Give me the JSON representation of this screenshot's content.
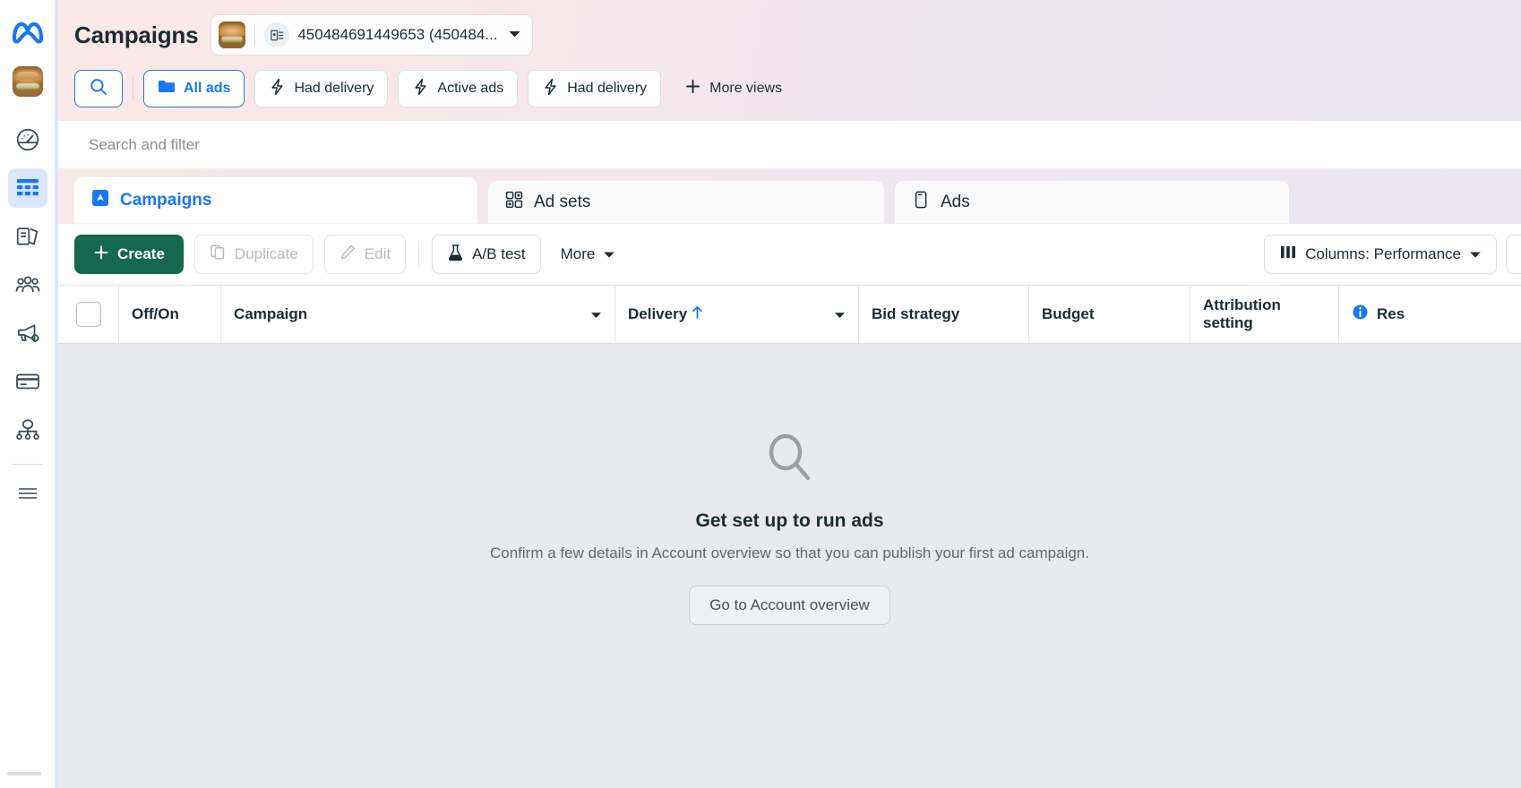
{
  "rail": {
    "logo_icon": "meta-logo-icon",
    "avatar_name": "account-avatar",
    "items": [
      {
        "icon": "gauge-icon",
        "name": "sidebar-item-overview",
        "active": false
      },
      {
        "icon": "table-icon",
        "name": "sidebar-item-campaigns",
        "active": true
      },
      {
        "icon": "pages-icon",
        "name": "sidebar-item-pages",
        "active": false
      },
      {
        "icon": "audience-icon",
        "name": "sidebar-item-audiences",
        "active": false
      },
      {
        "icon": "megaphone-gear-icon",
        "name": "sidebar-item-ad-tools",
        "active": false
      },
      {
        "icon": "credit-card-icon",
        "name": "sidebar-item-billing",
        "active": false
      },
      {
        "icon": "hierarchy-icon",
        "name": "sidebar-item-assets",
        "active": false
      },
      {
        "icon": "hamburger-icon",
        "name": "sidebar-item-all-tools",
        "active": false
      }
    ]
  },
  "header": {
    "title": "Campaigns",
    "account": {
      "label": "450484691449653 (450484...",
      "thumb_name": "account-thumbnail",
      "badge_icon": "ad-account-icon",
      "caret_icon": "chevron-down-icon"
    }
  },
  "filters": {
    "search_icon": "search-icon",
    "chips": [
      {
        "label": "All ads",
        "icon": "folder-icon",
        "selected": true
      },
      {
        "label": "Had delivery",
        "icon": "lightning-icon",
        "selected": false
      },
      {
        "label": "Active ads",
        "icon": "lightning-icon",
        "selected": false
      },
      {
        "label": "Had delivery",
        "icon": "lightning-icon",
        "selected": false
      }
    ],
    "more_views": {
      "label": "More views",
      "icon": "plus-icon"
    }
  },
  "search": {
    "placeholder": "Search and filter"
  },
  "tabs": [
    {
      "label": "Campaigns",
      "icon": "campaign-icon",
      "active": true
    },
    {
      "label": "Ad sets",
      "icon": "adsets-icon",
      "active": false
    },
    {
      "label": "Ads",
      "icon": "ads-icon",
      "active": false
    }
  ],
  "toolbar": {
    "create_label": "Create",
    "create_icon": "plus-icon",
    "duplicate_label": "Duplicate",
    "duplicate_icon": "duplicate-icon",
    "edit_label": "Edit",
    "edit_icon": "pencil-icon",
    "abtest_label": "A/B test",
    "abtest_icon": "flask-icon",
    "more_label": "More",
    "more_caret": "chevron-down-icon",
    "columns_label": "Columns: Performance",
    "columns_icon": "columns-icon",
    "columns_caret": "chevron-down-icon"
  },
  "table": {
    "columns": [
      {
        "key": "select",
        "label": "",
        "name": "select-all-checkbox"
      },
      {
        "key": "offon",
        "label": "Off/On",
        "name": "column-off-on"
      },
      {
        "key": "campaign",
        "label": "Campaign",
        "name": "column-campaign"
      },
      {
        "key": "delivery",
        "label": "Delivery",
        "name": "column-delivery",
        "sorted": "asc"
      },
      {
        "key": "bidstrategy",
        "label": "Bid strategy",
        "name": "column-bid-strategy"
      },
      {
        "key": "budget",
        "label": "Budget",
        "name": "column-budget"
      },
      {
        "key": "attribution",
        "label": "Attribution setting",
        "name": "column-attribution-setting"
      },
      {
        "key": "results",
        "label": "Res",
        "name": "column-results"
      }
    ]
  },
  "empty_state": {
    "icon": "magnifier-icon",
    "title": "Get set up to run ads",
    "subtitle": "Confirm a few details in Account overview so that you can publish your first ad campaign.",
    "button_label": "Go to Account overview"
  },
  "colors": {
    "brand_blue": "#1877f2",
    "create_green": "#13684e",
    "body_bg": "#e8eaed",
    "rail_active": "#dbe7f6"
  }
}
